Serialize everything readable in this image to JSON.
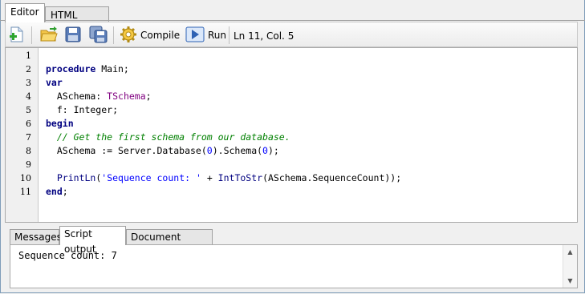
{
  "tabs": {
    "editor": "Editor",
    "html_output": "HTML output"
  },
  "toolbar": {
    "compile_label": "Compile",
    "run_label": "Run",
    "status": "Ln 11, Col. 5"
  },
  "editor": {
    "line_numbers": [
      "1",
      "2",
      "3",
      "4",
      "5",
      "6",
      "7",
      "8",
      "9",
      "10",
      "11"
    ],
    "lines": [
      [],
      [
        {
          "t": "procedure",
          "c": "kw"
        },
        {
          "t": " Main;",
          "c": ""
        }
      ],
      [
        {
          "t": "var",
          "c": "kw"
        }
      ],
      [
        {
          "t": "  ASchema: ",
          "c": ""
        },
        {
          "t": "TSchema",
          "c": "ty"
        },
        {
          "t": ";",
          "c": ""
        }
      ],
      [
        {
          "t": "  f: Integer;",
          "c": ""
        }
      ],
      [
        {
          "t": "begin",
          "c": "kw"
        }
      ],
      [
        {
          "t": "  // Get the first schema from our database.",
          "c": "cm"
        }
      ],
      [
        {
          "t": "  ASchema := Server.Database(",
          "c": ""
        },
        {
          "t": "0",
          "c": "nu"
        },
        {
          "t": ").Schema(",
          "c": ""
        },
        {
          "t": "0",
          "c": "nu"
        },
        {
          "t": ");",
          "c": ""
        }
      ],
      [],
      [
        {
          "t": "  ",
          "c": ""
        },
        {
          "t": "PrintLn",
          "c": "fn"
        },
        {
          "t": "(",
          "c": ""
        },
        {
          "t": "'Sequence count: '",
          "c": "st"
        },
        {
          "t": " + ",
          "c": ""
        },
        {
          "t": "IntToStr",
          "c": "fn"
        },
        {
          "t": "(ASchema.SequenceCount));",
          "c": ""
        }
      ],
      [
        {
          "t": "end",
          "c": "kw"
        },
        {
          "t": ";",
          "c": ""
        }
      ]
    ]
  },
  "bottom_tabs": {
    "messages": "Messages",
    "script_output": "Script output",
    "document_settings": "Document settings"
  },
  "output": {
    "text": "Sequence count: 7"
  },
  "icons": [
    "new-script-icon",
    "open-folder-icon",
    "save-icon",
    "save-all-icon",
    "compile-gear-icon",
    "run-play-icon",
    "scroll-up-icon",
    "scroll-down-icon"
  ]
}
